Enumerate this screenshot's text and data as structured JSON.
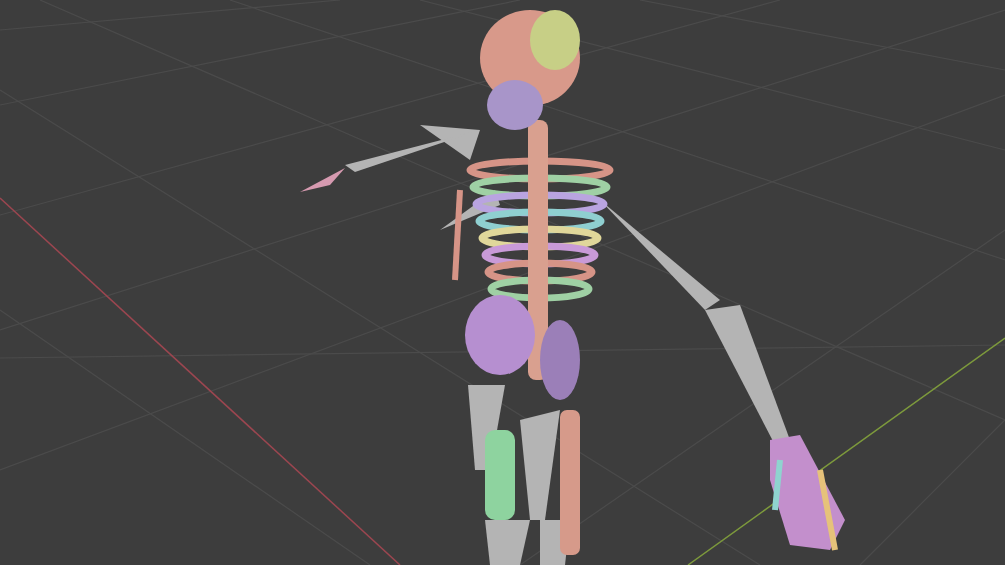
{
  "viewport": {
    "grid": true,
    "axes": [
      {
        "kind": "x",
        "color": "#9c4650"
      },
      {
        "kind": "y",
        "color": "#7d9a3c"
      }
    ]
  }
}
